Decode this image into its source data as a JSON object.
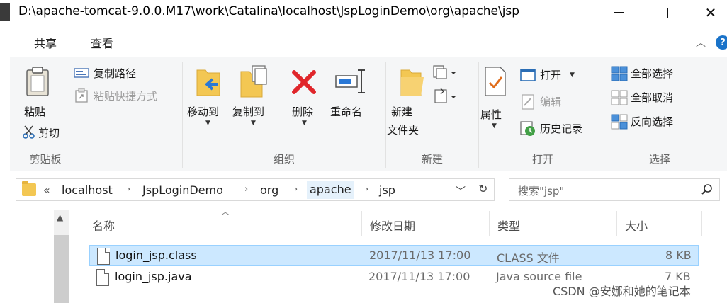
{
  "window": {
    "title": "D:\\apache-tomcat-9.0.0.M17\\work\\Catalina\\localhost\\JspLoginDemo\\org\\apache\\jsp",
    "close_glyph": "✕"
  },
  "tabs": [
    {
      "label": "共享"
    },
    {
      "label": "查看"
    }
  ],
  "ribbon": {
    "clipboard": {
      "paste_label": "粘贴",
      "copy_path_label": "复制路径",
      "paste_shortcut_label": "粘贴快捷方式",
      "cut_label": "剪切",
      "group_label": "剪贴板"
    },
    "organize": {
      "move_to_label": "移动到",
      "copy_to_label": "复制到",
      "delete_label": "删除",
      "rename_label": "重命名",
      "group_label": "组织"
    },
    "new": {
      "new_folder_label_1": "新建",
      "new_folder_label_2": "文件夹",
      "group_label": "新建"
    },
    "open": {
      "properties_label": "属性",
      "open_label": "打开",
      "edit_label": "编辑",
      "history_label": "历史记录",
      "group_label": "打开"
    },
    "select": {
      "select_all_label": "全部选择",
      "select_none_label": "全部取消",
      "invert_label": "反向选择",
      "group_label": "选择"
    }
  },
  "address": {
    "overflow": "«",
    "crumbs": [
      "localhost",
      "JspLoginDemo",
      "org",
      "apache",
      "jsp"
    ]
  },
  "search": {
    "placeholder": "搜索\"jsp\""
  },
  "columns": {
    "name": "名称",
    "date": "修改日期",
    "type": "类型",
    "size": "大小"
  },
  "files": [
    {
      "name": "login_jsp.class",
      "date": "2017/11/13 17:00",
      "type": "CLASS 文件",
      "size": "8 KB",
      "selected": true
    },
    {
      "name": "login_jsp.java",
      "date": "2017/11/13 17:00",
      "type": "Java source file",
      "size": "7 KB",
      "selected": false
    }
  ],
  "watermark": "CSDN @安娜和她的笔记本",
  "colors": {
    "selection": "#cce8ff",
    "accent": "#1a73c9",
    "folder": "#f3c753",
    "delete_red": "#e0262b"
  },
  "icons": {
    "paste": "clipboard-icon",
    "cut": "scissors-icon",
    "copy_path": "copy-path-icon",
    "paste_shortcut": "paste-shortcut-icon",
    "move_to": "move-to-icon",
    "copy_to": "copy-to-icon",
    "delete": "delete-x-icon",
    "rename": "rename-icon",
    "new_folder": "new-folder-icon",
    "properties": "properties-icon",
    "open": "open-icon",
    "edit": "edit-icon",
    "history": "history-icon",
    "select_all": "select-all-icon",
    "select_none": "select-none-icon",
    "invert": "invert-selection-icon",
    "search": "search-icon",
    "refresh": "refresh-icon"
  }
}
